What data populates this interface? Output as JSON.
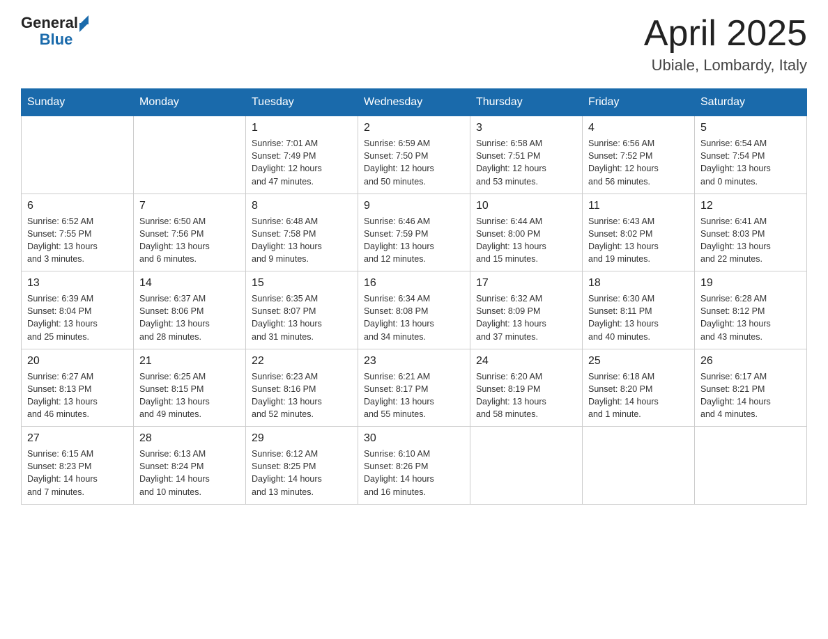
{
  "header": {
    "logo": {
      "general": "General",
      "blue": "Blue"
    },
    "title": "April 2025",
    "location": "Ubiale, Lombardy, Italy"
  },
  "calendar": {
    "days_of_week": [
      "Sunday",
      "Monday",
      "Tuesday",
      "Wednesday",
      "Thursday",
      "Friday",
      "Saturday"
    ],
    "weeks": [
      [
        {
          "day": "",
          "info": ""
        },
        {
          "day": "",
          "info": ""
        },
        {
          "day": "1",
          "info": "Sunrise: 7:01 AM\nSunset: 7:49 PM\nDaylight: 12 hours\nand 47 minutes."
        },
        {
          "day": "2",
          "info": "Sunrise: 6:59 AM\nSunset: 7:50 PM\nDaylight: 12 hours\nand 50 minutes."
        },
        {
          "day": "3",
          "info": "Sunrise: 6:58 AM\nSunset: 7:51 PM\nDaylight: 12 hours\nand 53 minutes."
        },
        {
          "day": "4",
          "info": "Sunrise: 6:56 AM\nSunset: 7:52 PM\nDaylight: 12 hours\nand 56 minutes."
        },
        {
          "day": "5",
          "info": "Sunrise: 6:54 AM\nSunset: 7:54 PM\nDaylight: 13 hours\nand 0 minutes."
        }
      ],
      [
        {
          "day": "6",
          "info": "Sunrise: 6:52 AM\nSunset: 7:55 PM\nDaylight: 13 hours\nand 3 minutes."
        },
        {
          "day": "7",
          "info": "Sunrise: 6:50 AM\nSunset: 7:56 PM\nDaylight: 13 hours\nand 6 minutes."
        },
        {
          "day": "8",
          "info": "Sunrise: 6:48 AM\nSunset: 7:58 PM\nDaylight: 13 hours\nand 9 minutes."
        },
        {
          "day": "9",
          "info": "Sunrise: 6:46 AM\nSunset: 7:59 PM\nDaylight: 13 hours\nand 12 minutes."
        },
        {
          "day": "10",
          "info": "Sunrise: 6:44 AM\nSunset: 8:00 PM\nDaylight: 13 hours\nand 15 minutes."
        },
        {
          "day": "11",
          "info": "Sunrise: 6:43 AM\nSunset: 8:02 PM\nDaylight: 13 hours\nand 19 minutes."
        },
        {
          "day": "12",
          "info": "Sunrise: 6:41 AM\nSunset: 8:03 PM\nDaylight: 13 hours\nand 22 minutes."
        }
      ],
      [
        {
          "day": "13",
          "info": "Sunrise: 6:39 AM\nSunset: 8:04 PM\nDaylight: 13 hours\nand 25 minutes."
        },
        {
          "day": "14",
          "info": "Sunrise: 6:37 AM\nSunset: 8:06 PM\nDaylight: 13 hours\nand 28 minutes."
        },
        {
          "day": "15",
          "info": "Sunrise: 6:35 AM\nSunset: 8:07 PM\nDaylight: 13 hours\nand 31 minutes."
        },
        {
          "day": "16",
          "info": "Sunrise: 6:34 AM\nSunset: 8:08 PM\nDaylight: 13 hours\nand 34 minutes."
        },
        {
          "day": "17",
          "info": "Sunrise: 6:32 AM\nSunset: 8:09 PM\nDaylight: 13 hours\nand 37 minutes."
        },
        {
          "day": "18",
          "info": "Sunrise: 6:30 AM\nSunset: 8:11 PM\nDaylight: 13 hours\nand 40 minutes."
        },
        {
          "day": "19",
          "info": "Sunrise: 6:28 AM\nSunset: 8:12 PM\nDaylight: 13 hours\nand 43 minutes."
        }
      ],
      [
        {
          "day": "20",
          "info": "Sunrise: 6:27 AM\nSunset: 8:13 PM\nDaylight: 13 hours\nand 46 minutes."
        },
        {
          "day": "21",
          "info": "Sunrise: 6:25 AM\nSunset: 8:15 PM\nDaylight: 13 hours\nand 49 minutes."
        },
        {
          "day": "22",
          "info": "Sunrise: 6:23 AM\nSunset: 8:16 PM\nDaylight: 13 hours\nand 52 minutes."
        },
        {
          "day": "23",
          "info": "Sunrise: 6:21 AM\nSunset: 8:17 PM\nDaylight: 13 hours\nand 55 minutes."
        },
        {
          "day": "24",
          "info": "Sunrise: 6:20 AM\nSunset: 8:19 PM\nDaylight: 13 hours\nand 58 minutes."
        },
        {
          "day": "25",
          "info": "Sunrise: 6:18 AM\nSunset: 8:20 PM\nDaylight: 14 hours\nand 1 minute."
        },
        {
          "day": "26",
          "info": "Sunrise: 6:17 AM\nSunset: 8:21 PM\nDaylight: 14 hours\nand 4 minutes."
        }
      ],
      [
        {
          "day": "27",
          "info": "Sunrise: 6:15 AM\nSunset: 8:23 PM\nDaylight: 14 hours\nand 7 minutes."
        },
        {
          "day": "28",
          "info": "Sunrise: 6:13 AM\nSunset: 8:24 PM\nDaylight: 14 hours\nand 10 minutes."
        },
        {
          "day": "29",
          "info": "Sunrise: 6:12 AM\nSunset: 8:25 PM\nDaylight: 14 hours\nand 13 minutes."
        },
        {
          "day": "30",
          "info": "Sunrise: 6:10 AM\nSunset: 8:26 PM\nDaylight: 14 hours\nand 16 minutes."
        },
        {
          "day": "",
          "info": ""
        },
        {
          "day": "",
          "info": ""
        },
        {
          "day": "",
          "info": ""
        }
      ]
    ]
  }
}
